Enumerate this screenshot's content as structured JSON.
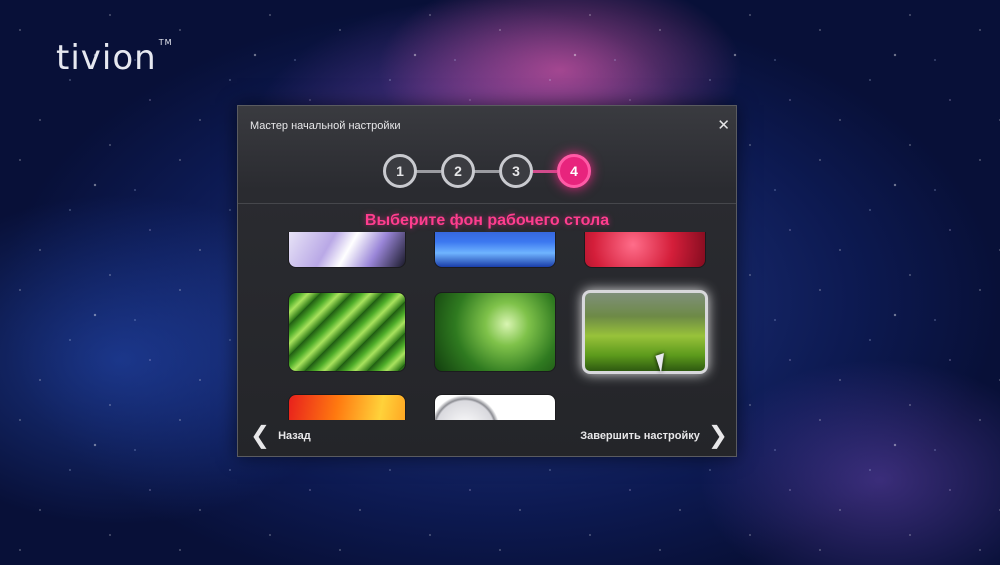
{
  "brand": {
    "logo": "tivion",
    "tm": "TM"
  },
  "dialog": {
    "title": "Мастер начальной настройки",
    "close_icon": "close-icon",
    "steps": [
      "1",
      "2",
      "3",
      "4"
    ],
    "active_step": 4,
    "heading": "Выберите фон рабочего стола",
    "back_label": "Назад",
    "finish_label": "Завершить настройку"
  },
  "wallpapers": [
    {
      "name": "abstract-lavender",
      "visible": "partial-top"
    },
    {
      "name": "blue-glow",
      "visible": "partial-top"
    },
    {
      "name": "red-flower",
      "visible": "partial-top"
    },
    {
      "name": "green-leaf-drop",
      "visible": "full"
    },
    {
      "name": "dew-leaf",
      "visible": "full"
    },
    {
      "name": "grass-field",
      "visible": "full",
      "selected": true
    },
    {
      "name": "orange-gradient",
      "visible": "partial-bottom"
    },
    {
      "name": "white-pebbles",
      "visible": "partial-bottom"
    }
  ],
  "colors": {
    "accent": "#e8247d",
    "heading": "#ff3d8e",
    "dialog_bg": "#2a2b30"
  }
}
